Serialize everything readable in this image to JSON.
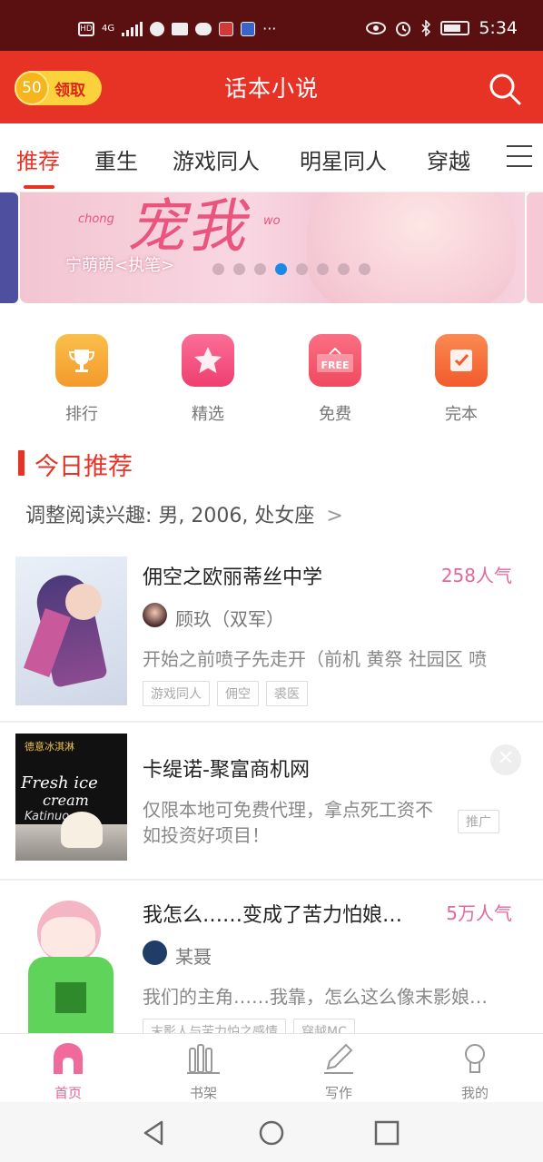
{
  "status_bar": {
    "time": "5:34",
    "left_badges": [
      "HD",
      "4G"
    ],
    "icons": [
      "hd-icon",
      "signal-icon",
      "vpn-icon",
      "briefcase-icon",
      "wechat-icon",
      "book-app-icon",
      "app-icon",
      "more-icon",
      "eye-icon",
      "alarm-icon",
      "bluetooth-icon",
      "battery-icon"
    ]
  },
  "header": {
    "coin_amount": "50",
    "claim_label": "领取",
    "title": "话本小说",
    "search_icon": "search-icon"
  },
  "tabs": [
    {
      "label": "推荐",
      "active": true
    },
    {
      "label": "重生",
      "active": false
    },
    {
      "label": "游戏同人",
      "active": false
    },
    {
      "label": "明星同人",
      "active": false
    },
    {
      "label": "穿越",
      "active": false
    }
  ],
  "banner": {
    "headline": "宠我",
    "pinyin_left": "chong",
    "pinyin_right": "wo",
    "byline": "宁萌萌<执笔>",
    "dot_count": 8,
    "active_dot": 3
  },
  "quick_entries": [
    {
      "label": "排行",
      "icon": "trophy-icon",
      "color": "#f7a534"
    },
    {
      "label": "精选",
      "icon": "star-icon",
      "color": "#f24b7c"
    },
    {
      "label": "免费",
      "icon": "free-icon",
      "color": "#f2536b"
    },
    {
      "label": "完本",
      "icon": "check-note-icon",
      "color": "#f46a3b"
    }
  ],
  "section": {
    "title": "今日推荐",
    "interest_text": "调整阅读兴趣: 男, 2006, 处女座"
  },
  "books": [
    {
      "title": "佣空之欧丽蒂丝中学",
      "popularity": "258人气",
      "author": "顾玖（双军）",
      "description": "开始之前喷子先走开（前机 黄祭 社园区 喷",
      "tags": [
        "游戏同人",
        "佣空",
        "裘医"
      ]
    },
    {
      "title": "我怎么……变成了苦力怕娘…",
      "popularity": "5万人气",
      "author": "某聂",
      "description": "我们的主角……我靠，怎么这么像末影娘…",
      "tags": [
        "末影人与苦力怕之感情",
        "穿越MC"
      ]
    }
  ],
  "ad": {
    "title": "卡缇诺-聚富商机网",
    "description": "仅限本地可免费代理，拿点死工资不如投资好项目！",
    "badge": "推广",
    "close_glyph": "✕",
    "cover_text_1": "Fresh ice",
    "cover_text_2": "cream",
    "cover_text_3": "Katinuo",
    "cover_top_text": "德意冰淇淋"
  },
  "bottom_nav": [
    {
      "label": "首页",
      "icon": "home-icon",
      "active": true
    },
    {
      "label": "书架",
      "icon": "bookshelf-icon",
      "active": false
    },
    {
      "label": "写作",
      "icon": "pen-icon",
      "active": false
    },
    {
      "label": "我的",
      "icon": "profile-icon",
      "active": false
    }
  ],
  "colors": {
    "brand_red": "#e63326",
    "status_bar": "#5a1010",
    "popularity_pink": "#e2679d",
    "active_dot_blue": "#1e88e5"
  }
}
